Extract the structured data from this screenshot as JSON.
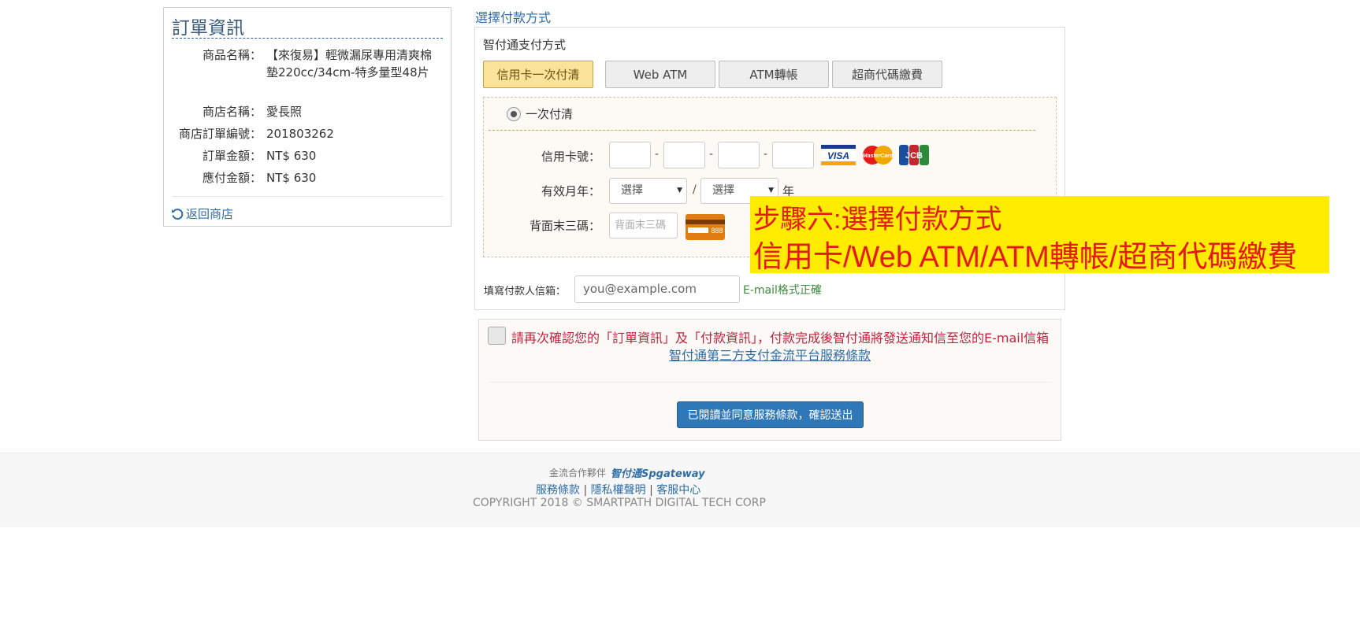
{
  "order": {
    "title": "訂單資訊",
    "rows": [
      {
        "label": "商品名稱：",
        "value": "【來復易】輕微漏尿專用清爽棉墊220cc/34cm-特多量型48片"
      },
      {
        "label": "商店名稱：",
        "value": "愛長照"
      },
      {
        "label": "商店訂單編號：",
        "value": "201803262"
      },
      {
        "label": "訂單金額：",
        "value": "NT$ 630"
      },
      {
        "label": "應付金額：",
        "value": "NT$ 630"
      }
    ],
    "back_label": "返回商店"
  },
  "payment": {
    "heading": "選擇付款方式",
    "provider_label": "智付通支付方式",
    "tabs": [
      {
        "label": "信用卡一次付清",
        "active": true
      },
      {
        "label": "Web ATM",
        "active": false
      },
      {
        "label": "ATM轉帳",
        "active": false
      },
      {
        "label": "超商代碼繳費",
        "active": false
      }
    ],
    "option_label": "一次付清",
    "card_number_label": "信用卡號：",
    "dash": "-",
    "expiry_label": "有效月年：",
    "month_select": "選擇",
    "year_select": "選擇",
    "slash": "/",
    "year_suffix": "年",
    "cvv_label": "背面末三碼：",
    "cvv_placeholder": "背面末三碼",
    "cvv_card_digits": "888",
    "card_brands": [
      "VISA",
      "MasterCard",
      "JCB"
    ],
    "email_label": "填寫付款人信箱：",
    "email_placeholder": "you@example.com",
    "email_status": "E-mail格式正確"
  },
  "confirm": {
    "text": "請再次確認您的「訂單資訊」及「付款資訊」，付款完成後智付通將發送通知信至您的E-mail信箱",
    "terms_link": "智付通第三方支付金流平台服務條款",
    "submit_label": "已閱讀並同意服務條款，確認送出"
  },
  "footer": {
    "partner_label": "金流合作夥伴",
    "partner_logo": "智付通Spgateway",
    "links": [
      "服務條款",
      "隱私權聲明",
      "客服中心"
    ],
    "separator": "|",
    "copyright": "COPYRIGHT 2018 © SMARTPATH DIGITAL TECH CORP"
  },
  "annotation": {
    "line1": "步驟六:選擇付款方式",
    "line2": "信用卡/Web ATM/ATM轉帳/超商代碼繳費"
  },
  "colors": {
    "link": "#2f6da3",
    "active_tab": "#fbe39a",
    "confirm_text": "#c0243f",
    "submit_button": "#2f78b7",
    "annotation_bg": "#ffec00",
    "annotation_text": "#e5191a"
  }
}
